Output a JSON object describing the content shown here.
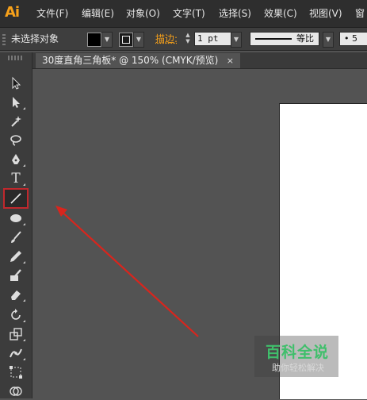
{
  "app": {
    "logo": "Ai",
    "accent_color": "#f7a11a"
  },
  "menu": [
    {
      "label": "文件(F)"
    },
    {
      "label": "编辑(E)"
    },
    {
      "label": "对象(O)"
    },
    {
      "label": "文字(T)"
    },
    {
      "label": "选择(S)"
    },
    {
      "label": "效果(C)"
    },
    {
      "label": "视图(V)"
    },
    {
      "label": "窗"
    }
  ],
  "control_bar": {
    "selection_status": "未选择对象",
    "fill_color": "#000000",
    "stroke_label": "描边:",
    "stroke_weight": "1 pt",
    "stroke_profile": "等比",
    "brush_size": "5"
  },
  "document_tab": {
    "title": "30度直角三角板* @ 150% (CMYK/预览)",
    "close": "×"
  },
  "tools": [
    {
      "name": "selection-tool-icon",
      "active": false
    },
    {
      "name": "direct-selection-tool-icon",
      "active": false
    },
    {
      "name": "magic-wand-tool-icon",
      "active": false
    },
    {
      "name": "lasso-tool-icon",
      "active": false
    },
    {
      "name": "pen-tool-icon",
      "active": false
    },
    {
      "name": "type-tool-icon",
      "active": false,
      "glyph": "T"
    },
    {
      "name": "line-segment-tool-icon",
      "active": true
    },
    {
      "name": "ellipse-tool-icon",
      "active": false
    },
    {
      "name": "paintbrush-tool-icon",
      "active": false
    },
    {
      "name": "pencil-tool-icon",
      "active": false
    },
    {
      "name": "blob-brush-tool-icon",
      "active": false
    },
    {
      "name": "eraser-tool-icon",
      "active": false
    },
    {
      "name": "rotate-tool-icon",
      "active": false
    },
    {
      "name": "scale-tool-icon",
      "active": false
    },
    {
      "name": "width-tool-icon",
      "active": false
    },
    {
      "name": "free-transform-tool-icon",
      "active": false
    },
    {
      "name": "shape-builder-tool-icon",
      "active": false
    }
  ],
  "annotation": {
    "arrow_color": "#d9251d",
    "highlight_color": "#c0282d"
  },
  "watermark": {
    "title": "百科全说",
    "subtitle": "助你轻松解决"
  }
}
